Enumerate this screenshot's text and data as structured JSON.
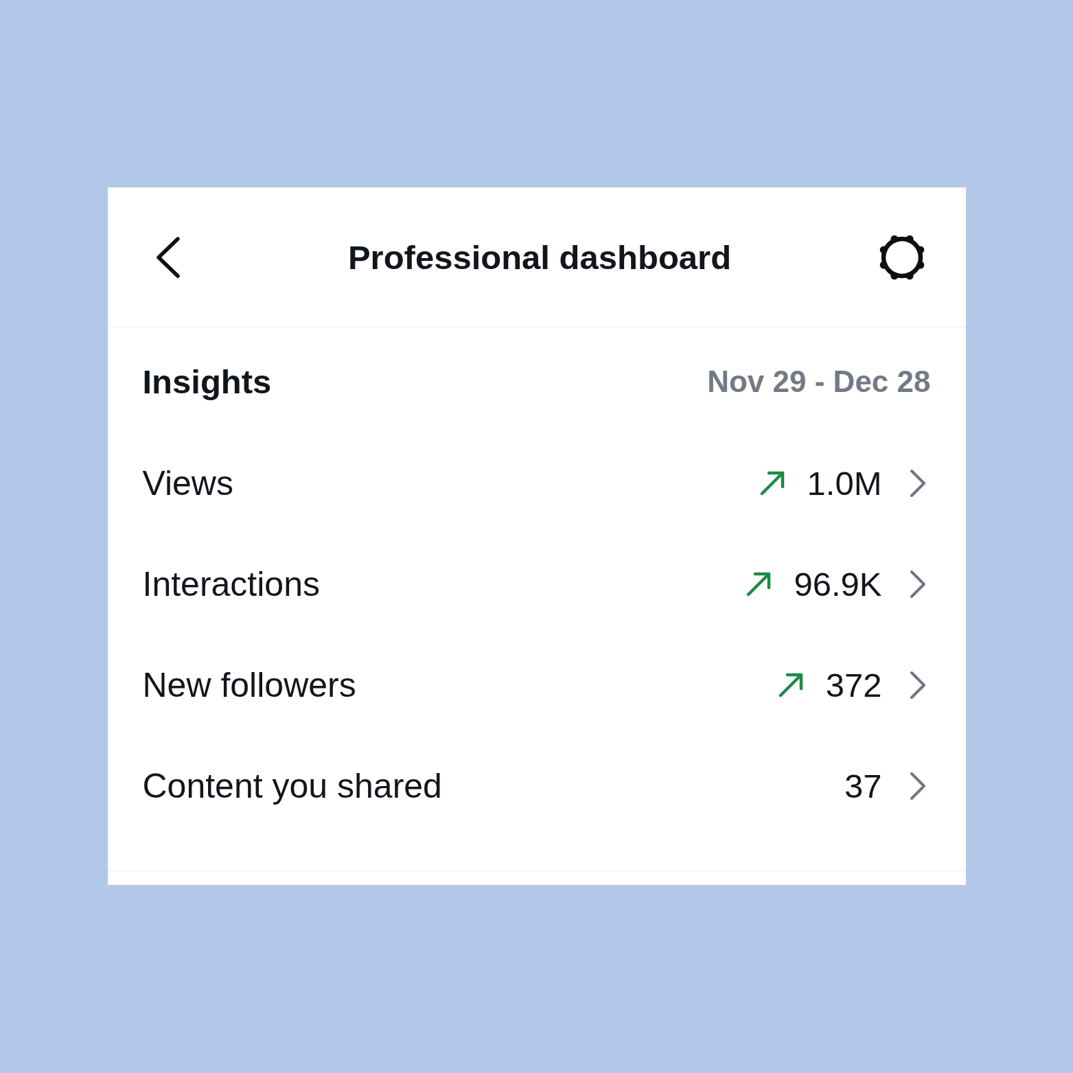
{
  "header": {
    "title": "Professional dashboard"
  },
  "insights": {
    "heading": "Insights",
    "date_range": "Nov 29 - Dec 28"
  },
  "metrics": [
    {
      "label": "Views",
      "value": "1.0M",
      "trending_up": true
    },
    {
      "label": "Interactions",
      "value": "96.9K",
      "trending_up": true
    },
    {
      "label": "New followers",
      "value": "372",
      "trending_up": true
    },
    {
      "label": "Content you shared",
      "value": "37",
      "trending_up": false
    }
  ]
}
